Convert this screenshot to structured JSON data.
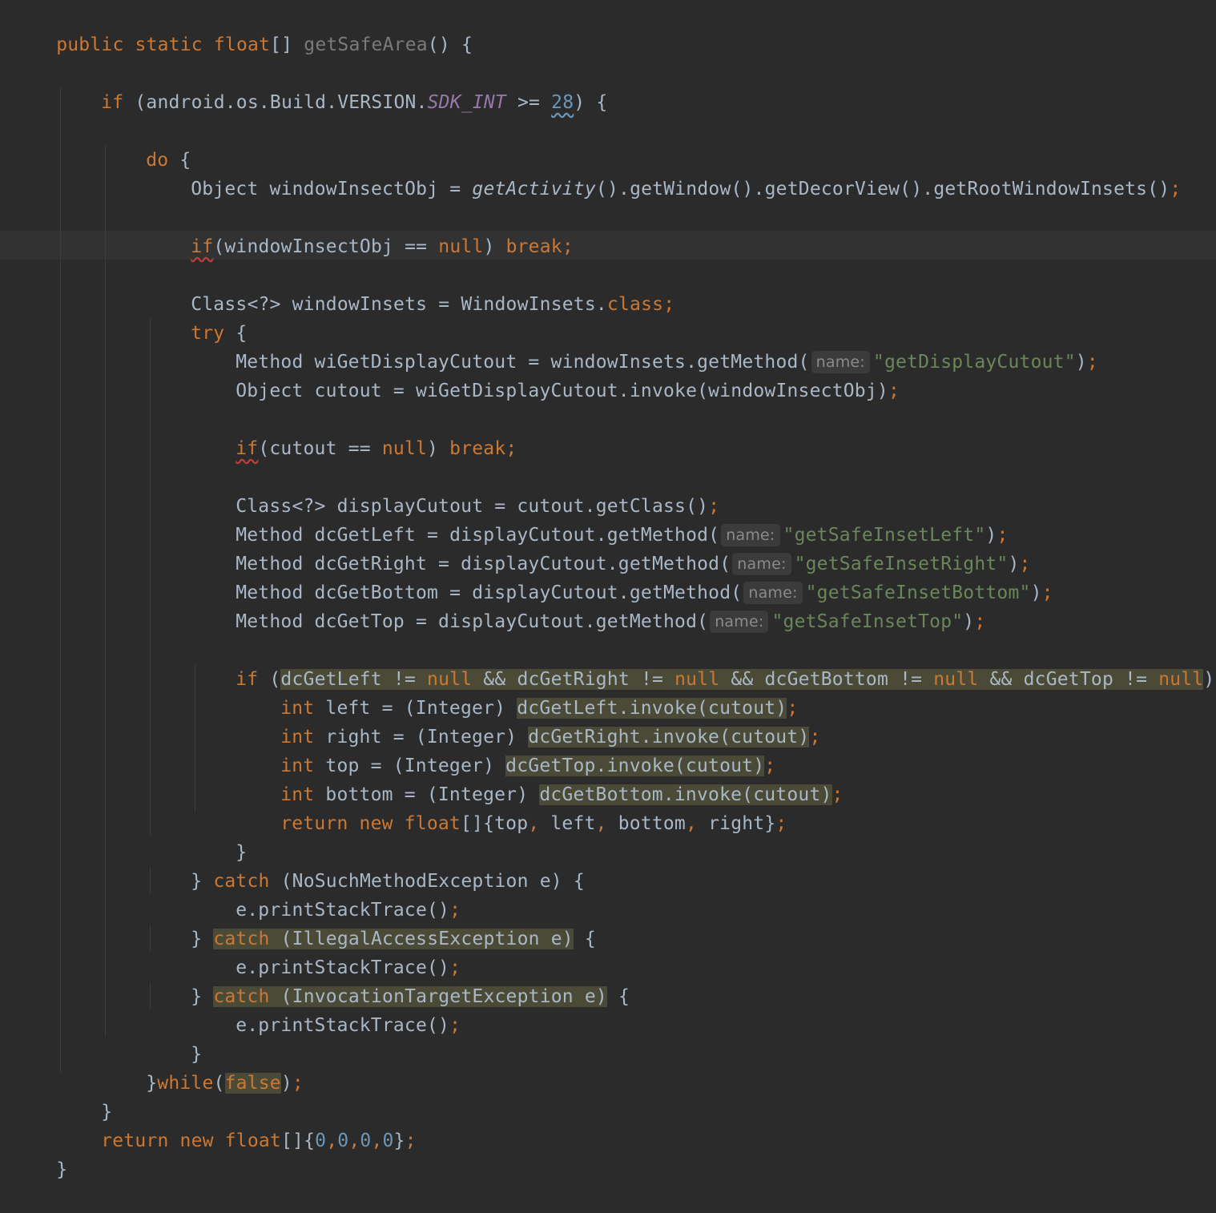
{
  "editor": {
    "lines": {
      "l1": {
        "a": "public static float",
        "b": "[] ",
        "c": "getSafeArea",
        "d": "() {"
      },
      "l3": {
        "a": "if ",
        "b": "(android.os.Build.VERSION.",
        "c": "SDK_INT",
        "d": " >= ",
        "e": "28",
        "f": ") {"
      },
      "l5": {
        "a": "do ",
        "b": "{"
      },
      "l6": {
        "a": "Object windowInsectObj = ",
        "b": "getActivity",
        "c": "().getWindow().getDecorView().getRootWindowInsets()",
        "d": ";"
      },
      "l8": {
        "a": "if",
        "b": "(windowInsectObj == ",
        "c": "null",
        "d": ") ",
        "e": "break;"
      },
      "l10": {
        "a": "Class<?> windowInsets = WindowInsets.",
        "b": "class",
        "c": ";"
      },
      "l11": {
        "a": "try ",
        "b": "{"
      },
      "l12": {
        "a": "Method wiGetDisplayCutout = windowInsets.getMethod(",
        "hint": "name:",
        "b": "\"getDisplayCutout\"",
        "c": ")",
        "d": ";"
      },
      "l13": {
        "a": "Object cutout = wiGetDisplayCutout.invoke(windowInsectObj)",
        "b": ";"
      },
      "l15": {
        "a": "if",
        "b": "(cutout == ",
        "c": "null",
        "d": ") ",
        "e": "break;"
      },
      "l17": {
        "a": "Class<?> displayCutout = cutout.getClass()",
        "b": ";"
      },
      "l18": {
        "a": "Method dcGetLeft = displayCutout.getMethod(",
        "hint": "name:",
        "b": "\"getSafeInsetLeft\"",
        "c": ")",
        "d": ";"
      },
      "l19": {
        "a": "Method dcGetRight = displayCutout.getMethod(",
        "hint": "name:",
        "b": "\"getSafeInsetRight\"",
        "c": ")",
        "d": ";"
      },
      "l20": {
        "a": "Method dcGetBottom = displayCutout.getMethod(",
        "hint": "name:",
        "b": "\"getSafeInsetBottom\"",
        "c": ")",
        "d": ";"
      },
      "l21": {
        "a": "Method dcGetTop = displayCutout.getMethod(",
        "hint": "name:",
        "b": "\"getSafeInsetTop\"",
        "c": ")",
        "d": ";"
      },
      "l23": {
        "a": "if ",
        "b": "(",
        "c1": "dcGetLeft != ",
        "n1": "null",
        "c2": " && dcGetRight != ",
        "n2": "null",
        "c3": " && dcGetBottom != ",
        "n3": "null",
        "c4": " && dcGetTop != ",
        "n4": "null",
        "d": ") {"
      },
      "l24": {
        "a": "int ",
        "b": "left = (Integer) ",
        "c": "dcGetLeft.invoke(cutout)",
        "d": ";"
      },
      "l25": {
        "a": "int ",
        "b": "right = (Integer) ",
        "c": "dcGetRight.invoke(cutout)",
        "d": ";"
      },
      "l26": {
        "a": "int ",
        "b": "top = (Integer) ",
        "c": "dcGetTop.invoke(cutout)",
        "d": ";"
      },
      "l27": {
        "a": "int ",
        "b": "bottom = (Integer) ",
        "c": "dcGetBottom.invoke(cutout)",
        "d": ";"
      },
      "l28": {
        "a": "return new float",
        "b": "[]{top",
        "c": ", ",
        "d": "left",
        "e": ", ",
        "f": "bottom",
        "g": ", ",
        "h": "right}",
        "i": ";"
      },
      "l29": {
        "a": "}"
      },
      "l30": {
        "a": "} ",
        "b": "catch ",
        "c": "(NoSuchMethodException e) {"
      },
      "l31": {
        "a": "e.printStackTrace()",
        "b": ";"
      },
      "l32": {
        "a": "} ",
        "b": "catch ",
        "c": "(IllegalAccessException e)",
        "d": " {"
      },
      "l33": {
        "a": "e.printStackTrace()",
        "b": ";"
      },
      "l34": {
        "a": "} ",
        "b": "catch ",
        "c": "(InvocationTargetException e)",
        "d": " {"
      },
      "l35": {
        "a": "e.printStackTrace()",
        "b": ";"
      },
      "l36": {
        "a": "}"
      },
      "l37": {
        "a": "}",
        "b": "while",
        "c": "(",
        "d": "false",
        "e": ")",
        "f": ";"
      },
      "l38": {
        "a": "}"
      },
      "l39": {
        "a": "return new float",
        "b": "[]{",
        "n1": "0",
        "s1": ",",
        "n2": "0",
        "s2": ",",
        "n3": "0",
        "s3": ",",
        "n4": "0",
        "c": "}",
        "d": ";"
      },
      "l40": {
        "a": "}"
      }
    },
    "colors": {
      "background": "#2b2b2b",
      "keyword": "#cc7832",
      "string": "#6a8759",
      "number": "#6897bb",
      "constant": "#9876aa",
      "identifier": "#a9b7c6",
      "highlight": "#4a4a37"
    }
  }
}
